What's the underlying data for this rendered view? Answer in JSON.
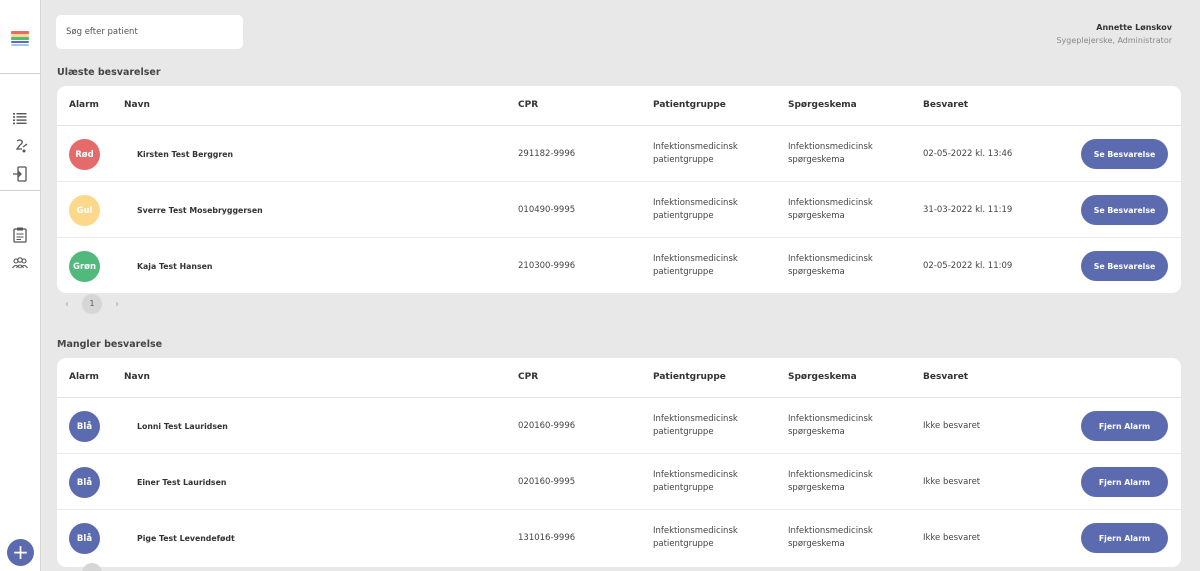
{
  "search": {
    "placeholder": "Søg efter patient"
  },
  "user": {
    "name": "Annette Lønskov",
    "role": "Sygeplejerske, Administrator"
  },
  "colors": {
    "accent": "#5c6bb0",
    "red": "#e56a6a",
    "yellow": "#fcd88a",
    "green": "#52b97d",
    "blue": "#5c6bb0"
  },
  "sidebar": {
    "icons": [
      "list-icon",
      "questionnaire-icon",
      "logout-icon",
      "clipboard-icon",
      "group-icon"
    ],
    "add_label": "+"
  },
  "columns": [
    "Alarm",
    "Navn",
    "CPR",
    "Patientgruppe",
    "Spørgeskema",
    "Besvaret"
  ],
  "unread": {
    "title": "Ulæste besvarelser",
    "rows": [
      {
        "alarm": "Rød",
        "color": "#e56a6a",
        "name": "Kirsten Test Berggren",
        "cpr": "291182-9996",
        "group_1": "Infektionsmedicinsk",
        "group_2": "patientgruppe",
        "form_1": "Infektionsmedicinsk",
        "form_2": "spørgeskema",
        "answered": "02-05-2022 kl. 13:46",
        "action": "Se Besvarelse"
      },
      {
        "alarm": "Gul",
        "color": "#fcd88a",
        "name": "Sverre Test Mosebryggersen",
        "cpr": "010490-9995",
        "group_1": "Infektionsmedicinsk",
        "group_2": "patientgruppe",
        "form_1": "Infektionsmedicinsk",
        "form_2": "spørgeskema",
        "answered": "31-03-2022 kl. 11:19",
        "action": "Se Besvarelse"
      },
      {
        "alarm": "Grøn",
        "color": "#52b97d",
        "name": "Kaja Test Hansen",
        "cpr": "210300-9996",
        "group_1": "Infektionsmedicinsk",
        "group_2": "patientgruppe",
        "form_1": "Infektionsmedicinsk",
        "form_2": "spørgeskema",
        "answered": "02-05-2022 kl. 11:09",
        "action": "Se Besvarelse"
      }
    ],
    "pager": {
      "prev": "‹",
      "page": "1",
      "next": "›"
    }
  },
  "missing": {
    "title": "Mangler besvarelse",
    "rows": [
      {
        "alarm": "Blå",
        "color": "#5c6bb0",
        "name": "Lonni Test Lauridsen",
        "cpr": "020160-9996",
        "group_1": "Infektionsmedicinsk",
        "group_2": "patientgruppe",
        "form_1": "Infektionsmedicinsk",
        "form_2": "spørgeskema",
        "answered": "Ikke besvaret",
        "action": "Fjern Alarm"
      },
      {
        "alarm": "Blå",
        "color": "#5c6bb0",
        "name": "Einer Test Lauridsen",
        "cpr": "020160-9995",
        "group_1": "Infektionsmedicinsk",
        "group_2": "patientgruppe",
        "form_1": "Infektionsmedicinsk",
        "form_2": "spørgeskema",
        "answered": "Ikke besvaret",
        "action": "Fjern Alarm"
      },
      {
        "alarm": "Blå",
        "color": "#5c6bb0",
        "name": "Pige Test Levendefødt",
        "cpr": "131016-9996",
        "group_1": "Infektionsmedicinsk",
        "group_2": "patientgruppe",
        "form_1": "Infektionsmedicinsk",
        "form_2": "spørgeskema",
        "answered": "Ikke besvaret",
        "action": "Fjern Alarm"
      }
    ]
  }
}
